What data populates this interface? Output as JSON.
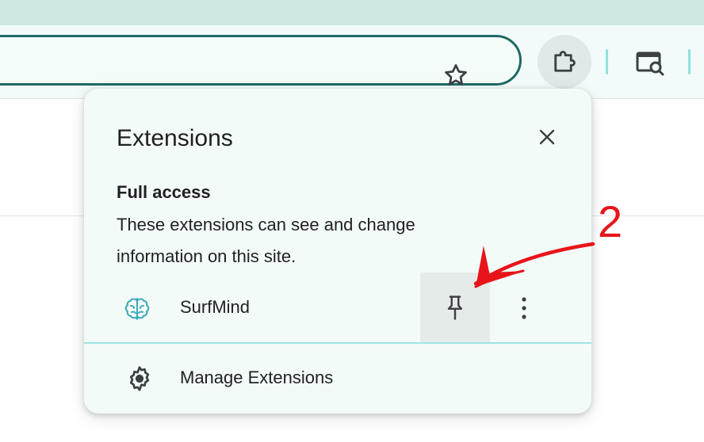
{
  "browser": {
    "bookmark_icon": "star-icon",
    "extensions_icon": "puzzle-icon",
    "lens_icon": "search-page-icon"
  },
  "popup": {
    "title": "Extensions",
    "close_icon": "close-icon",
    "section_title": "Full access",
    "section_desc": "These extensions can see and change information on this site.",
    "extensions": [
      {
        "name": "SurfMind",
        "icon": "brain-icon",
        "pin_icon": "pin-icon",
        "more_icon": "more-vert-icon"
      }
    ],
    "manage_label": "Manage Extensions",
    "manage_icon": "gear-icon"
  },
  "annotation": {
    "number": "2",
    "color": "#e8141a"
  },
  "colors": {
    "accent": "#1f6a62",
    "teal_light": "#9ee6e0",
    "toolbar_bg": "#f2fbf9",
    "top_strip": "#cfe8e3"
  }
}
